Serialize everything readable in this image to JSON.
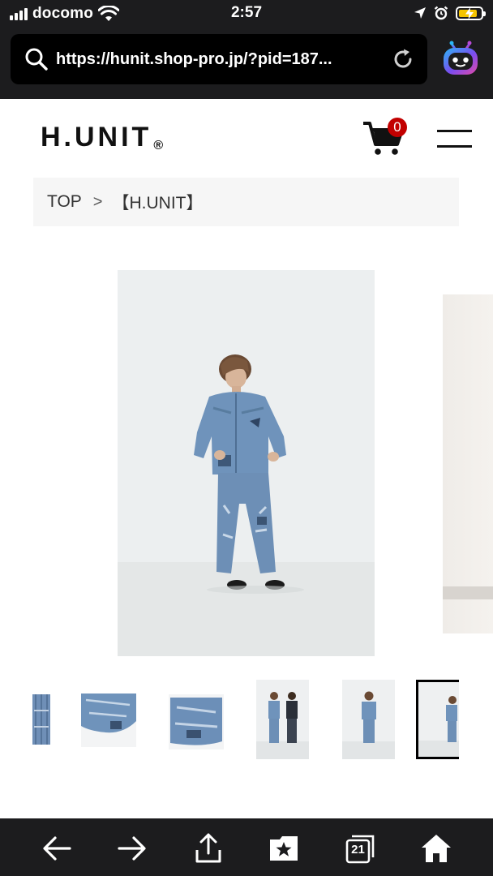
{
  "status_bar": {
    "carrier": "docomo",
    "time": "2:57",
    "battery_color": "#f5c400"
  },
  "browser": {
    "url": "https://hunit.shop-pro.jp/?pid=187...",
    "search_icon": "search-icon",
    "reload_icon": "reload-icon",
    "assistant_icon": "bot-icon"
  },
  "site": {
    "logo_text": "H.UNIT",
    "logo_mark": "®",
    "cart_count": "0",
    "cart_badge_color": "#c20000",
    "cart_icon": "cart-icon",
    "menu_icon": "hamburger-menu-icon"
  },
  "breadcrumb": {
    "items": [
      "TOP",
      "【H.UNIT】"
    ],
    "separator": ">"
  },
  "gallery": {
    "main_image": "model-in-denim-jacket-and-jeans",
    "thumbnails": [
      "denim-detail-strip",
      "jacket-hem-detail",
      "jacket-cuff-detail",
      "two-models-standing",
      "model-front-view",
      "model-side-view"
    ],
    "active_thumbnail": 5
  },
  "toolbar": {
    "tab_count": "21",
    "icons": [
      "back-arrow-icon",
      "forward-arrow-icon",
      "share-icon",
      "bookmarks-icon",
      "tabs-icon",
      "home-icon"
    ]
  }
}
